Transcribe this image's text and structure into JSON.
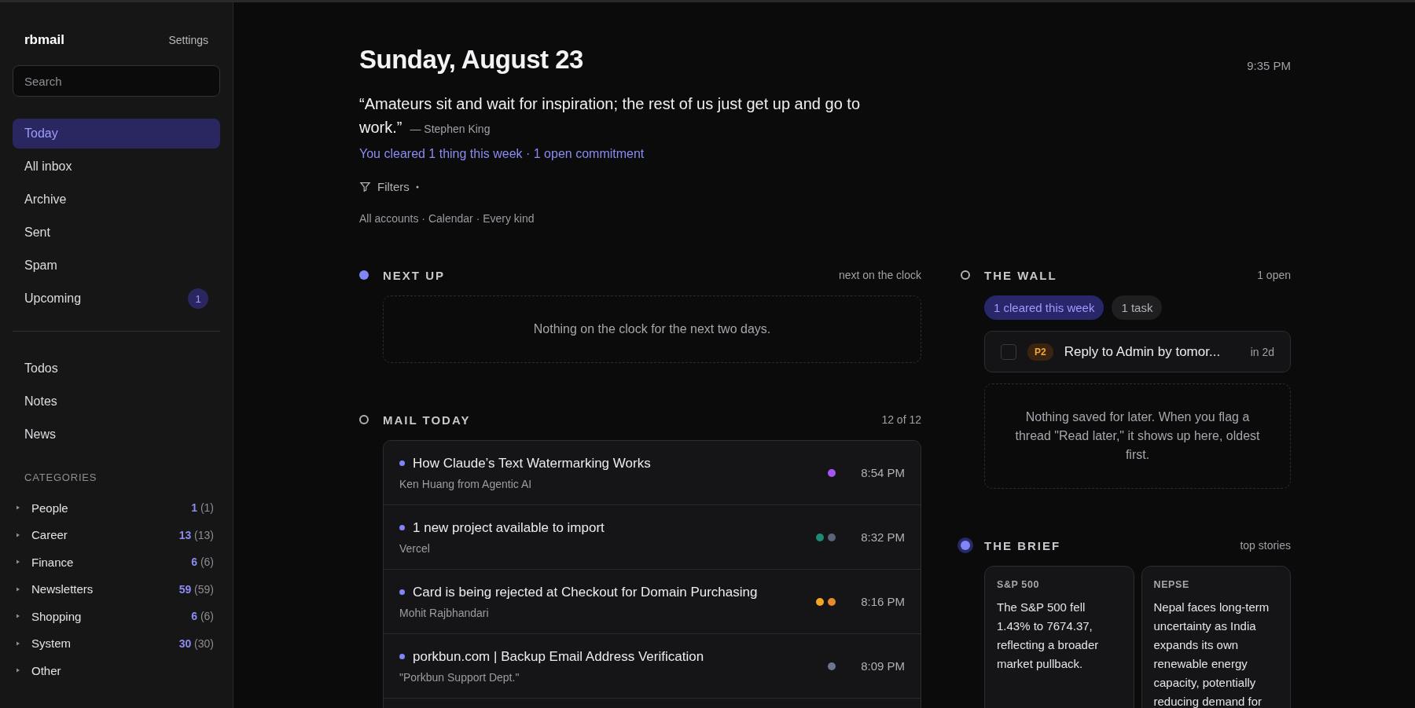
{
  "sidebar": {
    "brand": "rbmail",
    "settings": "Settings",
    "search": {
      "placeholder": "Search"
    },
    "nav": [
      {
        "label": "Today",
        "selected": true
      },
      {
        "label": "All inbox",
        "selected": false
      },
      {
        "label": "Archive",
        "selected": false
      },
      {
        "label": "Sent",
        "selected": false
      },
      {
        "label": "Spam",
        "selected": false
      },
      {
        "label": "Upcoming",
        "selected": false,
        "badge": "1"
      }
    ],
    "tools": [
      {
        "label": "Todos",
        "selected": false
      },
      {
        "label": "Notes",
        "selected": false
      },
      {
        "label": "News",
        "selected": false
      }
    ],
    "categories_heading": "CATEGORIES",
    "categories": [
      {
        "label": "People",
        "unread": "1",
        "total": "(1)"
      },
      {
        "label": "Career",
        "unread": "13",
        "total": "(13)"
      },
      {
        "label": "Finance",
        "unread": "6",
        "total": "(6)"
      },
      {
        "label": "Newsletters",
        "unread": "59",
        "total": "(59)"
      },
      {
        "label": "Shopping",
        "unread": "6",
        "total": "(6)"
      },
      {
        "label": "System",
        "unread": "30",
        "total": "(30)"
      },
      {
        "label": "Other"
      }
    ]
  },
  "header": {
    "date": "Sunday, August 23",
    "time": "9:35 PM",
    "quote": "“Amateurs sit and wait for inspiration; the rest of us just get up and go to work.”",
    "author": "— Stephen King",
    "stats": "You cleared 1 thing this week · 1 open commitment",
    "filters": "Filters",
    "filter_summary": "All accounts · Calendar · Every kind"
  },
  "next_up": {
    "title": "NEXT UP",
    "kind": "filled",
    "note": "next on the clock",
    "empty": "Nothing on the clock for the next two days."
  },
  "mail_today": {
    "title": "MAIL TODAY",
    "kind": "ring",
    "note": "12 of 12",
    "rows": [
      {
        "subject": "How Claude’s Text Watermarking Works",
        "from": "Ken Huang from Agentic AI",
        "time": "8:54 PM",
        "unread": true,
        "tags": [
          {
            "color": "#a855f7"
          }
        ]
      },
      {
        "subject": "1 new project available to import",
        "from": "Vercel",
        "time": "8:32 PM",
        "unread": true,
        "tags": [
          {
            "color": "#1f8a78"
          },
          {
            "color": "#5b6478"
          }
        ]
      },
      {
        "subject": "Card is being rejected at Checkout for Domain Purchasing",
        "from": "Mohit Rajbhandari",
        "time": "8:16 PM",
        "unread": true,
        "tags": [
          {
            "color": "#f5a524"
          },
          {
            "color": "#e8892b"
          }
        ]
      },
      {
        "subject": "porkbun.com | Backup Email Address Verification",
        "from": "\"Porkbun Support Dept.\"",
        "time": "8:09 PM",
        "unread": true,
        "tags": [
          {
            "color": "#6b7590"
          }
        ]
      }
    ]
  },
  "wall": {
    "title": "THE WALL",
    "kind": "ring",
    "note": "1 open",
    "chips": [
      {
        "label": "1 cleared this week",
        "selected": true
      },
      {
        "label": "1 task",
        "selected": false
      }
    ],
    "tasks": [
      {
        "priority": "P2",
        "title": "Reply to Admin by tomor...",
        "due": "in 2d",
        "checked": false
      }
    ],
    "empty": "Nothing saved for later. When you flag a thread \"Read later,\" it shows up here, oldest first."
  },
  "brief": {
    "title": "THE BRIEF",
    "kind": "halo",
    "note": "top stories",
    "stories": [
      {
        "label": "S&P 500",
        "text": "The S&P 500 fell 1.43% to 7674.37, reflecting a broader market pullback."
      },
      {
        "label": "NEPSE",
        "text": "Nepal faces long-term uncertainty as India expands its own renewable energy capacity, potentially reducing demand for"
      }
    ]
  }
}
